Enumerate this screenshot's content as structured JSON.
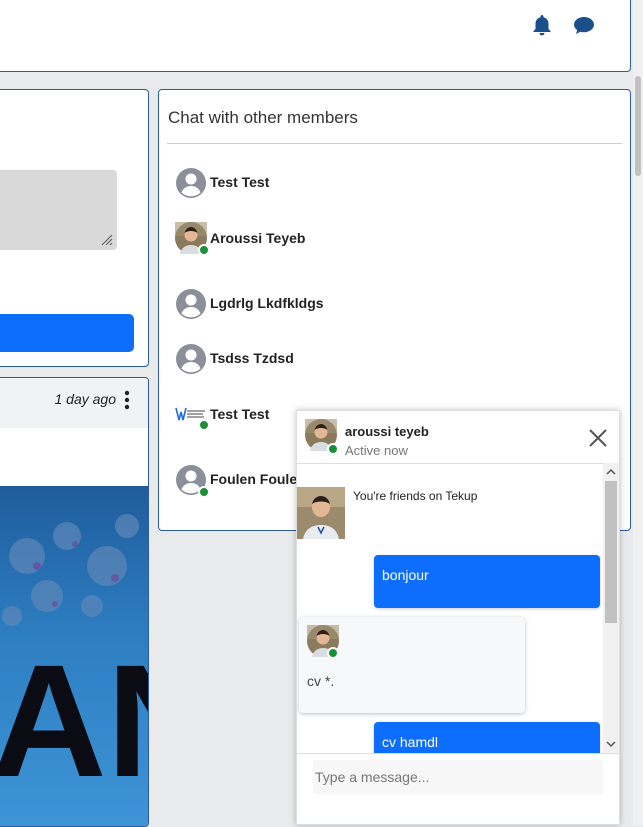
{
  "header": {
    "icons": [
      "bell-icon",
      "chat-bubble-icon"
    ]
  },
  "post": {
    "time": "1 day ago",
    "image_text": "AN"
  },
  "chat_panel": {
    "title": "Chat with other members",
    "members": [
      {
        "name": "Test Test",
        "avatar": "default-user-icon",
        "online": false
      },
      {
        "name": "Aroussi Teyeb",
        "avatar": "photo",
        "online": true
      },
      {
        "name": "Lgdrlg Lkdfkldgs",
        "avatar": "default-user-icon",
        "online": false
      },
      {
        "name": "Tsdss Tzdsd",
        "avatar": "default-user-icon",
        "online": false
      },
      {
        "name": "Test Test",
        "avatar": "worksoup-logo",
        "online": true
      },
      {
        "name": "Foulen Fouler",
        "avatar": "default-user-icon",
        "online": true
      }
    ]
  },
  "chat_popup": {
    "name": "aroussi teyeb",
    "status": "Active now",
    "friends_text": "You're friends on Tekup",
    "messages": [
      {
        "from": "me",
        "text": "bonjour"
      },
      {
        "from": "them",
        "text": "cv *."
      },
      {
        "from": "me",
        "text": "cv hamdl"
      }
    ],
    "input_placeholder": "Type a message..."
  },
  "colors": {
    "accent": "#0d6efd",
    "border": "#2c5aa0",
    "online": "#1a8f3a"
  }
}
